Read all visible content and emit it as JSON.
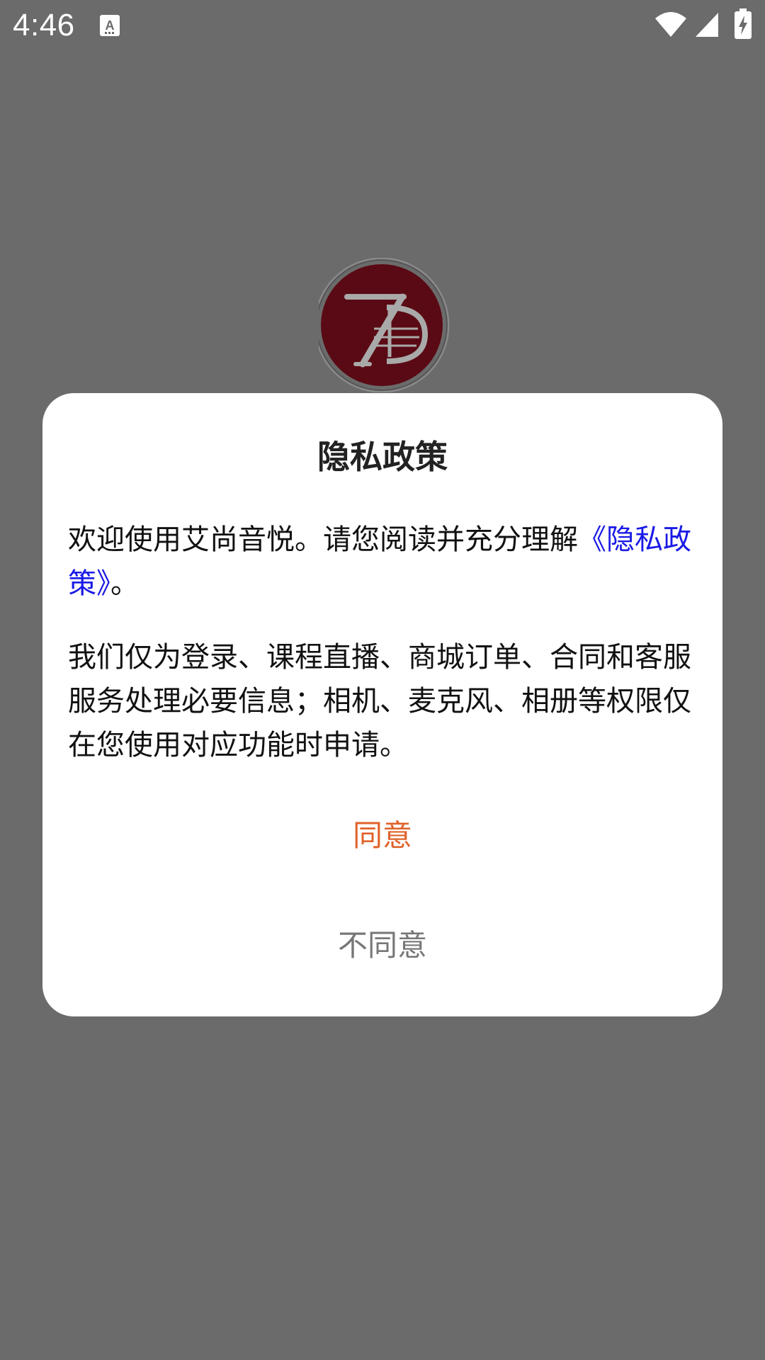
{
  "status_bar": {
    "time": "4:46",
    "notification_icon": "text-a-icon",
    "wifi_icon": "wifi-icon",
    "signal_icon": "cell-signal-icon",
    "battery_icon": "battery-charging-icon"
  },
  "logo": {
    "icon": "brand-logo-icon",
    "color": "#5a0a14"
  },
  "dialog": {
    "title": "隐私政策",
    "para1_text": "欢迎使用艾尚音悦。请您阅读并充分理解",
    "para1_link": "《隐私政策》",
    "para1_tail": "。",
    "para2_text": "我们仅为登录、课程直播、商城订单、合同和客服服务处理必要信息；相机、麦克风、相册等权限仅在您使用对应功能时申请。",
    "agree_label": "同意",
    "disagree_label": "不同意",
    "link_color": "#1a1ae6",
    "agree_color": "#e0622a"
  }
}
